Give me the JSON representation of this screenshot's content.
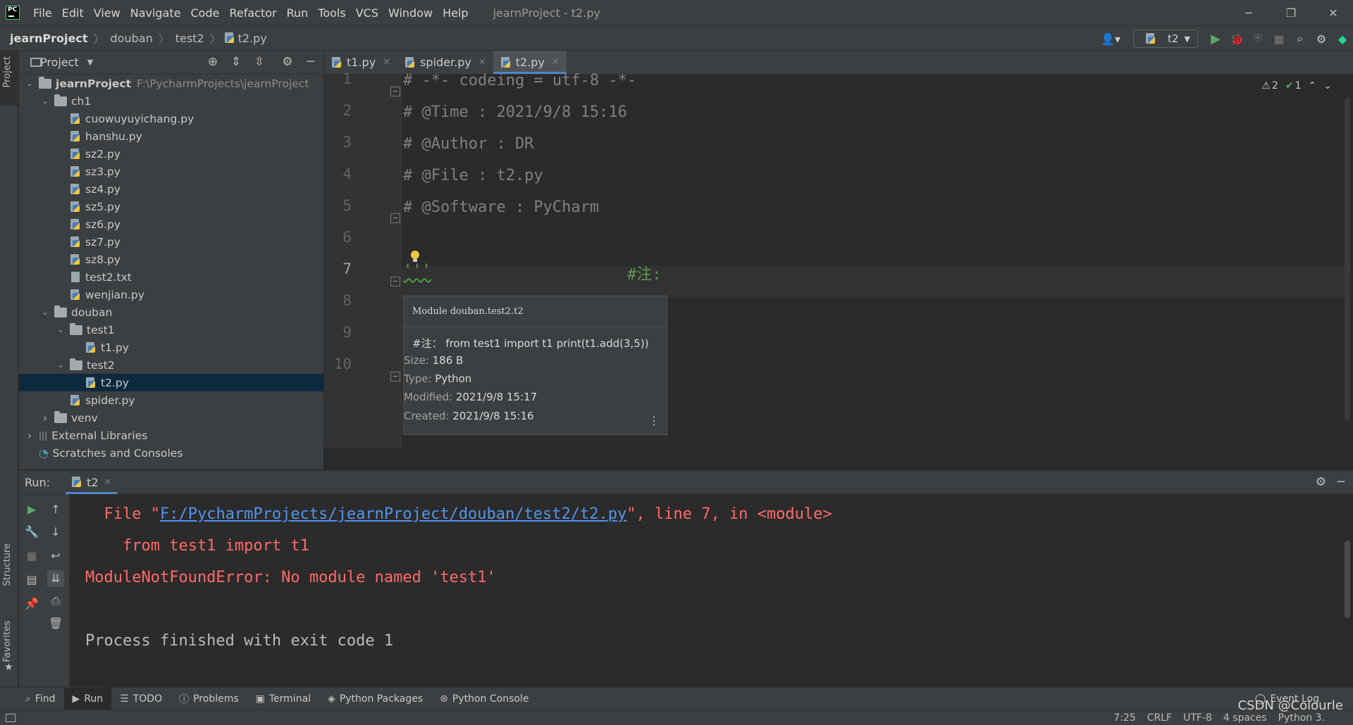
{
  "titlebar": {
    "menu": [
      "File",
      "Edit",
      "View",
      "Navigate",
      "Code",
      "Refactor",
      "Run",
      "Tools",
      "VCS",
      "Window",
      "Help"
    ],
    "window_title": "jearnProject - t2.py",
    "minimize": "─",
    "restore": "❐",
    "close": "✕"
  },
  "navbar": {
    "breadcrumbs": [
      "jearnProject",
      "douban",
      "test2",
      "t2.py"
    ],
    "run_config": "t2"
  },
  "left_stripe": {
    "project_tab": "Project",
    "structure_tab": "Structure",
    "favorites_tab": "Favorites"
  },
  "project_panel": {
    "title": "Project",
    "tree": [
      {
        "label": "jearnProject",
        "path": "F:\\PycharmProjects\\jearnProject",
        "type": "folder",
        "depth": 0,
        "expanded": true
      },
      {
        "label": "ch1",
        "type": "folder",
        "depth": 1,
        "expanded": true
      },
      {
        "label": "cuowuyuyichang.py",
        "type": "py",
        "depth": 2
      },
      {
        "label": "hanshu.py",
        "type": "py",
        "depth": 2
      },
      {
        "label": "sz2.py",
        "type": "py",
        "depth": 2
      },
      {
        "label": "sz3.py",
        "type": "py",
        "depth": 2
      },
      {
        "label": "sz4.py",
        "type": "py",
        "depth": 2
      },
      {
        "label": "sz5.py",
        "type": "py",
        "depth": 2
      },
      {
        "label": "sz6.py",
        "type": "py",
        "depth": 2
      },
      {
        "label": "sz7.py",
        "type": "py",
        "depth": 2
      },
      {
        "label": "sz8.py",
        "type": "py",
        "depth": 2
      },
      {
        "label": "test2.txt",
        "type": "txt",
        "depth": 2
      },
      {
        "label": "wenjian.py",
        "type": "py",
        "depth": 2
      },
      {
        "label": "douban",
        "type": "folder",
        "depth": 1,
        "expanded": true
      },
      {
        "label": "test1",
        "type": "folder",
        "depth": 2,
        "expanded": true
      },
      {
        "label": "t1.py",
        "type": "py",
        "depth": 3
      },
      {
        "label": "test2",
        "type": "folder",
        "depth": 2,
        "expanded": true
      },
      {
        "label": "t2.py",
        "type": "py",
        "depth": 3,
        "selected": true
      },
      {
        "label": "spider.py",
        "type": "py",
        "depth": 2
      },
      {
        "label": "venv",
        "type": "folder",
        "depth": 1,
        "expanded": false
      },
      {
        "label": "External Libraries",
        "type": "lib",
        "depth": 0,
        "expanded": false
      },
      {
        "label": "Scratches and Consoles",
        "type": "scratch",
        "depth": 0
      }
    ]
  },
  "editor_tabs": [
    {
      "label": "t1.py",
      "active": false
    },
    {
      "label": "spider.py",
      "active": false
    },
    {
      "label": "t2.py",
      "active": true
    }
  ],
  "editor": {
    "inspection": {
      "warnings": "2",
      "ok": "1"
    },
    "line_numbers": [
      "1",
      "2",
      "3",
      "4",
      "5",
      "6",
      "7",
      "8",
      "9",
      "10"
    ],
    "lines": [
      "# -*- codeing = utf-8 -*-",
      "# @Time : 2021/9/8 15:16",
      "# @Author : DR",
      "# @File : t2.py",
      "# @Software : PyCharm",
      "",
      "'''",
      "",
      "",
      ""
    ],
    "line7_comment": "#注:"
  },
  "doc_popup": {
    "title": "Module douban.test2.t2",
    "summary": "#注： from test1 import t1 print(t1.add(3,5))",
    "size_label": "Size:",
    "size": "186 B",
    "type_label": "Type:",
    "type": "Python",
    "modified_label": "Modified:",
    "modified": "2021/9/8 15:17",
    "created_label": "Created:",
    "created": "2021/9/8 15:16"
  },
  "run_panel": {
    "label": "Run:",
    "tab": "t2",
    "console": {
      "file_prefix": "  File \"",
      "file_link": "F:/PycharmProjects/jearnProject/douban/test2/t2.py",
      "file_suffix": "\", line 7, in <module>",
      "import_line": "    from test1 import t1",
      "error_line": "ModuleNotFoundError: No module named 'test1'",
      "exit_line": "Process finished with exit code 1"
    }
  },
  "bottom_tools": [
    "Find",
    "Run",
    "TODO",
    "Problems",
    "Terminal",
    "Python Packages",
    "Python Console"
  ],
  "event_log": "Event Log",
  "statusbar": {
    "position": "7:25",
    "line_sep": "CRLF",
    "encoding": "UTF-8",
    "indent": "4 spaces",
    "interpreter": "Python 3."
  },
  "watermark": "CSDN @Colourle",
  "colors": {
    "accent": "#4a88c7",
    "error": "#ff6b68",
    "link": "#5394ec",
    "comment": "#808080",
    "docstring": "#629755"
  }
}
